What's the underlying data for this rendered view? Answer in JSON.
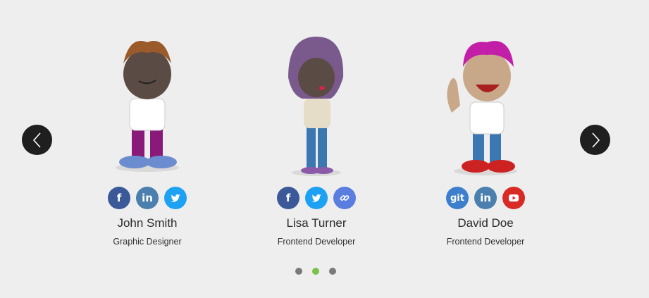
{
  "carousel": {
    "prev_icon": "chevron-left-icon",
    "next_icon": "chevron-right-icon",
    "active_dot": 1,
    "dot_count": 3
  },
  "members": [
    {
      "name": "John Smith",
      "role": "Graphic Designer",
      "socials": [
        {
          "icon": "facebook-icon",
          "color": "#3b5998"
        },
        {
          "icon": "linkedin-icon",
          "color": "#4a7fae"
        },
        {
          "icon": "twitter-icon",
          "color": "#1da1f2"
        }
      ]
    },
    {
      "name": "Lisa Turner",
      "role": "Frontend Developer",
      "socials": [
        {
          "icon": "facebook-icon",
          "color": "#3b5998"
        },
        {
          "icon": "twitter-icon",
          "color": "#1da1f2"
        },
        {
          "icon": "link-icon",
          "color": "#5a7de0"
        }
      ]
    },
    {
      "name": "David Doe",
      "role": "Frontend Developer",
      "socials": [
        {
          "icon": "git-icon",
          "color": "#3d7fcc",
          "label": "git"
        },
        {
          "icon": "linkedin-icon",
          "color": "#4a7fae"
        },
        {
          "icon": "youtube-icon",
          "color": "#d92b26"
        }
      ]
    }
  ],
  "colors": {
    "active_dot": "#7bc24a",
    "inactive_dot": "#7a7a7a",
    "arrow_bg": "#1f1f1f"
  }
}
